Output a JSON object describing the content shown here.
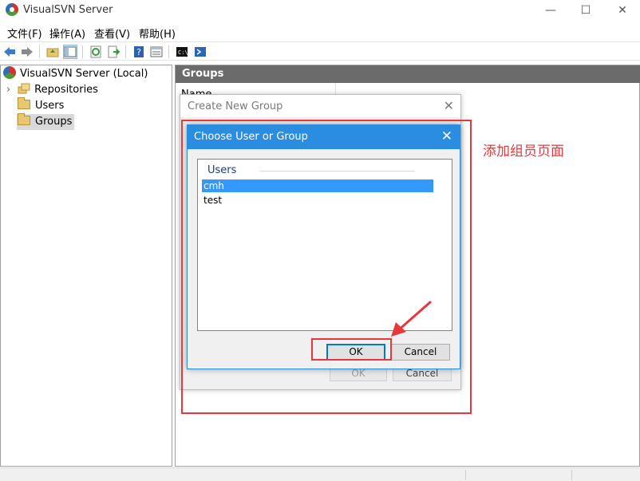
{
  "window": {
    "title": "VisualSVN Server",
    "minimize": "—",
    "maximize": "☐",
    "close": "✕"
  },
  "menu": [
    "文件(F)",
    "操作(A)",
    "查看(V)",
    "帮助(H)"
  ],
  "tree": {
    "root": "VisualSVN Server (Local)",
    "items": [
      {
        "label": "Repositories",
        "expander": "›"
      },
      {
        "label": "Users"
      },
      {
        "label": "Groups",
        "selected": true
      }
    ]
  },
  "right_pane": {
    "header": "Groups",
    "column_partial": "Name"
  },
  "create_dialog": {
    "title": "Create New Group",
    "close": "✕",
    "ok_label": "OK",
    "cancel_label": "Cancel"
  },
  "choose_dialog": {
    "title": "Choose User or Group",
    "close": "✕",
    "group_label": "Users",
    "users": [
      "cmh",
      "test"
    ],
    "selected_index": 0,
    "ok_label": "OK",
    "cancel_label": "Cancel"
  },
  "annotation": {
    "text": "添加组员页面",
    "color": "#e8383d"
  },
  "colors": {
    "accent": "#2b8de0",
    "selection": "#3399ff",
    "header_gray": "#6b6b6b"
  }
}
